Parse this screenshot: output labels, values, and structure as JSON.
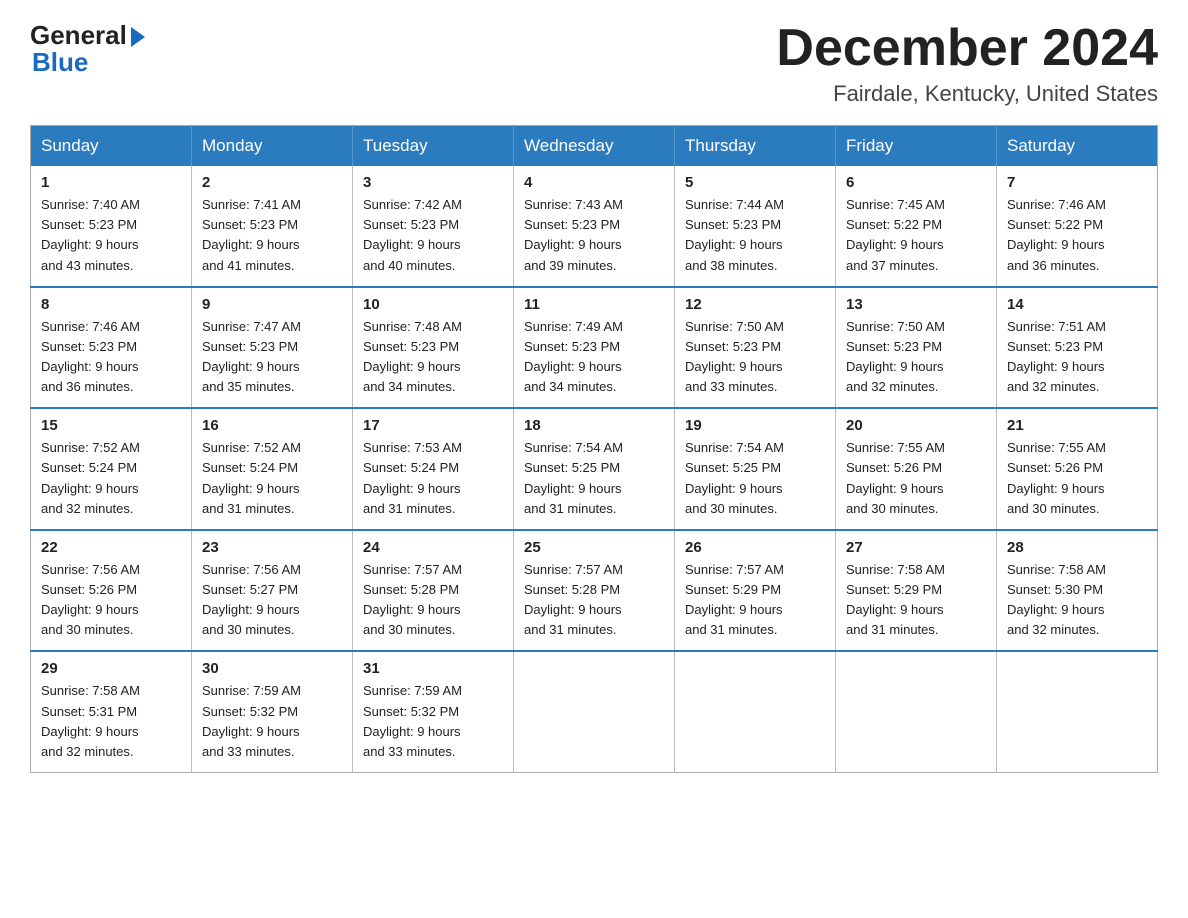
{
  "header": {
    "logo_general": "General",
    "logo_blue": "Blue",
    "month_title": "December 2024",
    "location": "Fairdale, Kentucky, United States"
  },
  "weekdays": [
    "Sunday",
    "Monday",
    "Tuesday",
    "Wednesday",
    "Thursday",
    "Friday",
    "Saturday"
  ],
  "weeks": [
    [
      {
        "day": "1",
        "sunrise": "7:40 AM",
        "sunset": "5:23 PM",
        "daylight": "9 hours and 43 minutes."
      },
      {
        "day": "2",
        "sunrise": "7:41 AM",
        "sunset": "5:23 PM",
        "daylight": "9 hours and 41 minutes."
      },
      {
        "day": "3",
        "sunrise": "7:42 AM",
        "sunset": "5:23 PM",
        "daylight": "9 hours and 40 minutes."
      },
      {
        "day": "4",
        "sunrise": "7:43 AM",
        "sunset": "5:23 PM",
        "daylight": "9 hours and 39 minutes."
      },
      {
        "day": "5",
        "sunrise": "7:44 AM",
        "sunset": "5:23 PM",
        "daylight": "9 hours and 38 minutes."
      },
      {
        "day": "6",
        "sunrise": "7:45 AM",
        "sunset": "5:22 PM",
        "daylight": "9 hours and 37 minutes."
      },
      {
        "day": "7",
        "sunrise": "7:46 AM",
        "sunset": "5:22 PM",
        "daylight": "9 hours and 36 minutes."
      }
    ],
    [
      {
        "day": "8",
        "sunrise": "7:46 AM",
        "sunset": "5:23 PM",
        "daylight": "9 hours and 36 minutes."
      },
      {
        "day": "9",
        "sunrise": "7:47 AM",
        "sunset": "5:23 PM",
        "daylight": "9 hours and 35 minutes."
      },
      {
        "day": "10",
        "sunrise": "7:48 AM",
        "sunset": "5:23 PM",
        "daylight": "9 hours and 34 minutes."
      },
      {
        "day": "11",
        "sunrise": "7:49 AM",
        "sunset": "5:23 PM",
        "daylight": "9 hours and 34 minutes."
      },
      {
        "day": "12",
        "sunrise": "7:50 AM",
        "sunset": "5:23 PM",
        "daylight": "9 hours and 33 minutes."
      },
      {
        "day": "13",
        "sunrise": "7:50 AM",
        "sunset": "5:23 PM",
        "daylight": "9 hours and 32 minutes."
      },
      {
        "day": "14",
        "sunrise": "7:51 AM",
        "sunset": "5:23 PM",
        "daylight": "9 hours and 32 minutes."
      }
    ],
    [
      {
        "day": "15",
        "sunrise": "7:52 AM",
        "sunset": "5:24 PM",
        "daylight": "9 hours and 32 minutes."
      },
      {
        "day": "16",
        "sunrise": "7:52 AM",
        "sunset": "5:24 PM",
        "daylight": "9 hours and 31 minutes."
      },
      {
        "day": "17",
        "sunrise": "7:53 AM",
        "sunset": "5:24 PM",
        "daylight": "9 hours and 31 minutes."
      },
      {
        "day": "18",
        "sunrise": "7:54 AM",
        "sunset": "5:25 PM",
        "daylight": "9 hours and 31 minutes."
      },
      {
        "day": "19",
        "sunrise": "7:54 AM",
        "sunset": "5:25 PM",
        "daylight": "9 hours and 30 minutes."
      },
      {
        "day": "20",
        "sunrise": "7:55 AM",
        "sunset": "5:26 PM",
        "daylight": "9 hours and 30 minutes."
      },
      {
        "day": "21",
        "sunrise": "7:55 AM",
        "sunset": "5:26 PM",
        "daylight": "9 hours and 30 minutes."
      }
    ],
    [
      {
        "day": "22",
        "sunrise": "7:56 AM",
        "sunset": "5:26 PM",
        "daylight": "9 hours and 30 minutes."
      },
      {
        "day": "23",
        "sunrise": "7:56 AM",
        "sunset": "5:27 PM",
        "daylight": "9 hours and 30 minutes."
      },
      {
        "day": "24",
        "sunrise": "7:57 AM",
        "sunset": "5:28 PM",
        "daylight": "9 hours and 30 minutes."
      },
      {
        "day": "25",
        "sunrise": "7:57 AM",
        "sunset": "5:28 PM",
        "daylight": "9 hours and 31 minutes."
      },
      {
        "day": "26",
        "sunrise": "7:57 AM",
        "sunset": "5:29 PM",
        "daylight": "9 hours and 31 minutes."
      },
      {
        "day": "27",
        "sunrise": "7:58 AM",
        "sunset": "5:29 PM",
        "daylight": "9 hours and 31 minutes."
      },
      {
        "day": "28",
        "sunrise": "7:58 AM",
        "sunset": "5:30 PM",
        "daylight": "9 hours and 32 minutes."
      }
    ],
    [
      {
        "day": "29",
        "sunrise": "7:58 AM",
        "sunset": "5:31 PM",
        "daylight": "9 hours and 32 minutes."
      },
      {
        "day": "30",
        "sunrise": "7:59 AM",
        "sunset": "5:32 PM",
        "daylight": "9 hours and 33 minutes."
      },
      {
        "day": "31",
        "sunrise": "7:59 AM",
        "sunset": "5:32 PM",
        "daylight": "9 hours and 33 minutes."
      },
      null,
      null,
      null,
      null
    ]
  ],
  "labels": {
    "sunrise": "Sunrise:",
    "sunset": "Sunset:",
    "daylight": "Daylight:"
  }
}
